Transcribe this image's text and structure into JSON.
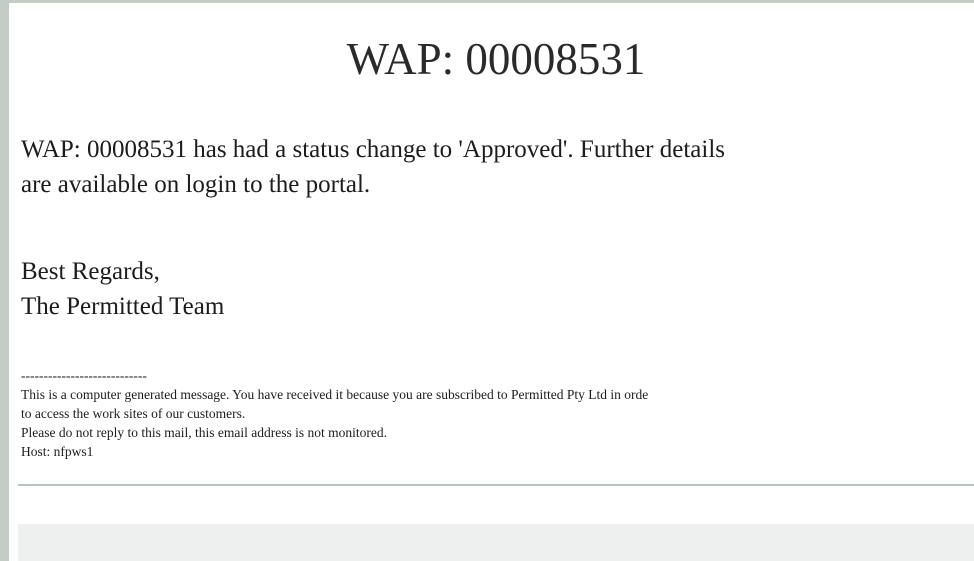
{
  "email": {
    "title": "WAP: 00008531",
    "message_line1": "WAP: 00008531 has had a status change to 'Approved'. Further details",
    "message_line2": "are available on login to the portal.",
    "sign_off": "Best Regards,",
    "signature": "The Permitted Team"
  },
  "footer": {
    "separator": "----------------------------",
    "line1": "This is a computer generated message. You have received it because you are subscribed to Permitted Pty Ltd in orde",
    "line2": "to access the work sites of our customers.",
    "line3": "Please do not reply to this mail, this email address is not monitored.",
    "line4": "Host: nfpws1"
  }
}
